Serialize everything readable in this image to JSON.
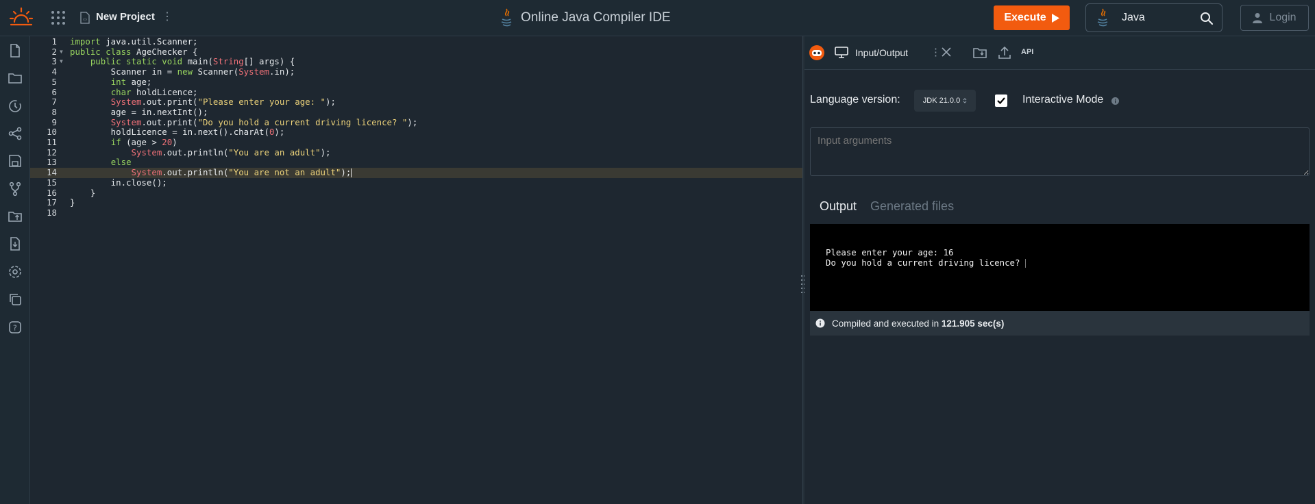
{
  "header": {
    "project_name": "New Project",
    "title": "Online Java Compiler IDE",
    "execute_label": "Execute",
    "language": "Java",
    "login_label": "Login"
  },
  "sidebar": {
    "items": [
      "new-file-icon",
      "folder-icon",
      "history-icon",
      "share-icon",
      "save-icon",
      "git-branch-icon",
      "upload-folder-icon",
      "download-icon",
      "settings-icon",
      "copy-icon",
      "help-icon"
    ]
  },
  "editor": {
    "lines": [
      {
        "n": "1",
        "fold": "",
        "html": "<span class=\"kw\">import</span> java.util.Scanner;"
      },
      {
        "n": "2",
        "fold": "▼",
        "html": "<span class=\"kw\">public class</span> AgeChecker {"
      },
      {
        "n": "3",
        "fold": "▼",
        "html": "    <span class=\"kw\">public static void</span> main(<span class=\"cls\">String</span>[] args) {"
      },
      {
        "n": "4",
        "fold": "",
        "html": "        Scanner in = <span class=\"kw\">new</span> Scanner(<span class=\"cls\">System</span>.in);"
      },
      {
        "n": "5",
        "fold": "",
        "html": "        <span class=\"kw\">int</span> age;"
      },
      {
        "n": "6",
        "fold": "",
        "html": "        <span class=\"kw\">char</span> holdLicence;"
      },
      {
        "n": "7",
        "fold": "",
        "html": "        <span class=\"cls\">System</span>.out.print(<span class=\"str\">\"Please enter your age: \"</span>);"
      },
      {
        "n": "8",
        "fold": "",
        "html": "        age = in.nextInt();"
      },
      {
        "n": "9",
        "fold": "",
        "html": "        <span class=\"cls\">System</span>.out.print(<span class=\"str\">\"Do you hold a current driving licence? \"</span>);"
      },
      {
        "n": "10",
        "fold": "",
        "html": "        holdLicence = in.next().charAt(<span class=\"num\">0</span>);"
      },
      {
        "n": "11",
        "fold": "",
        "html": "        <span class=\"kw\">if</span> (age &gt; <span class=\"num\">20</span>)"
      },
      {
        "n": "12",
        "fold": "",
        "html": "            <span class=\"cls\">System</span>.out.println(<span class=\"str\">\"You are an adult\"</span>);"
      },
      {
        "n": "13",
        "fold": "",
        "html": "        <span class=\"kw\">else</span>"
      },
      {
        "n": "14",
        "fold": "",
        "html": "            <span class=\"cls\">System</span>.out.println(<span class=\"str\">\"You are not an adult\"</span>);<span class=\"cursor\"></span>",
        "active": true
      },
      {
        "n": "15",
        "fold": "",
        "html": "        in.close();"
      },
      {
        "n": "16",
        "fold": "",
        "html": "    }"
      },
      {
        "n": "17",
        "fold": "",
        "html": "}"
      },
      {
        "n": "18",
        "fold": "",
        "html": ""
      }
    ]
  },
  "panel": {
    "tab_label": "Input/Output",
    "api_label": "API",
    "language_version_label": "Language version:",
    "jdk_version": "JDK 21.0.0",
    "interactive_label": "Interactive Mode",
    "interactive_checked": true,
    "args_placeholder": "Input arguments",
    "output_tab": "Output",
    "generated_tab": "Generated files",
    "output_text": "Please enter your age: 16\nDo you hold a current driving licence? ",
    "status_prefix": "Compiled and executed in ",
    "status_time": "121.905 sec(s)"
  },
  "colors": {
    "accent": "#f25b0f",
    "background": "#1e2730",
    "keyword": "#98d45f",
    "class": "#f07178",
    "string": "#ecd27a"
  }
}
